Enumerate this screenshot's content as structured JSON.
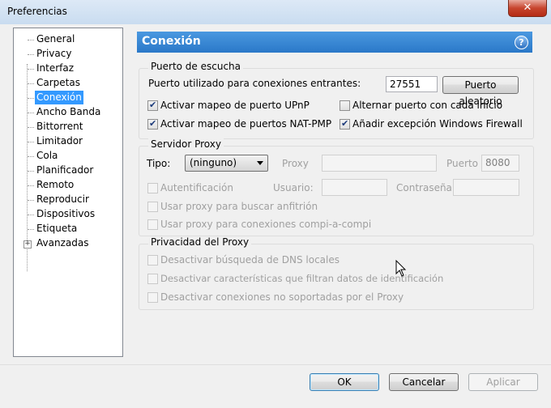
{
  "window": {
    "title": "Preferencias",
    "close_glyph": "✕"
  },
  "sidebar": {
    "items": [
      {
        "label": "General"
      },
      {
        "label": "Privacy"
      },
      {
        "label": "Interfaz"
      },
      {
        "label": "Carpetas"
      },
      {
        "label": "Conexión",
        "selected": true
      },
      {
        "label": "Ancho Banda"
      },
      {
        "label": "Bittorrent"
      },
      {
        "label": "Limitador"
      },
      {
        "label": "Cola"
      },
      {
        "label": "Planificador"
      },
      {
        "label": "Remoto"
      },
      {
        "label": "Reproducir"
      },
      {
        "label": "Dispositivos"
      },
      {
        "label": "Etiqueta"
      },
      {
        "label": "Avanzadas",
        "expandable": true
      }
    ],
    "expander_glyph": "+"
  },
  "header": {
    "title": "Conexión",
    "help_glyph": "?"
  },
  "listen_port": {
    "legend": "Puerto de escucha",
    "port_label": "Puerto utilizado para conexiones entrantes:",
    "port_value": "27551",
    "random_port_button": "Puerto aleatorio",
    "upnp": {
      "label": "Activar mapeo de puerto UPnP",
      "checked": true
    },
    "natpmp": {
      "label": "Activar mapeo de puertos NAT-PMP",
      "checked": true
    },
    "alternate": {
      "label": "Alternar puerto con cada inicio",
      "checked": false
    },
    "firewall": {
      "label": "Añadir excepción Windows Firewall",
      "checked": true
    }
  },
  "proxy": {
    "legend": "Servidor Proxy",
    "type_label": "Tipo:",
    "type_value": "(ninguno)",
    "proxy_label": "Proxy",
    "proxy_value": "",
    "port_label": "Puerto",
    "port_value": "8080",
    "auth": {
      "label": "Autentificación",
      "checked": false
    },
    "user_label": "Usuario:",
    "user_value": "",
    "password_label": "Contraseña",
    "password_value": "",
    "hostname": {
      "label": "Usar proxy para buscar anfitrión",
      "checked": false
    },
    "p2p": {
      "label": "Usar proxy para conexiones compi-a-compi",
      "checked": false
    }
  },
  "privacy": {
    "legend": "Privacidad del Proxy",
    "dns": {
      "label": "Desactivar búsqueda de DNS locales",
      "checked": false
    },
    "identifying": {
      "label": "Desactivar características que filtran datos de identificación",
      "checked": false
    },
    "unsupported": {
      "label": "Desactivar conexiones no soportadas por el Proxy",
      "checked": false
    }
  },
  "footer": {
    "ok": "OK",
    "cancel": "Cancelar",
    "apply": "Aplicar"
  }
}
